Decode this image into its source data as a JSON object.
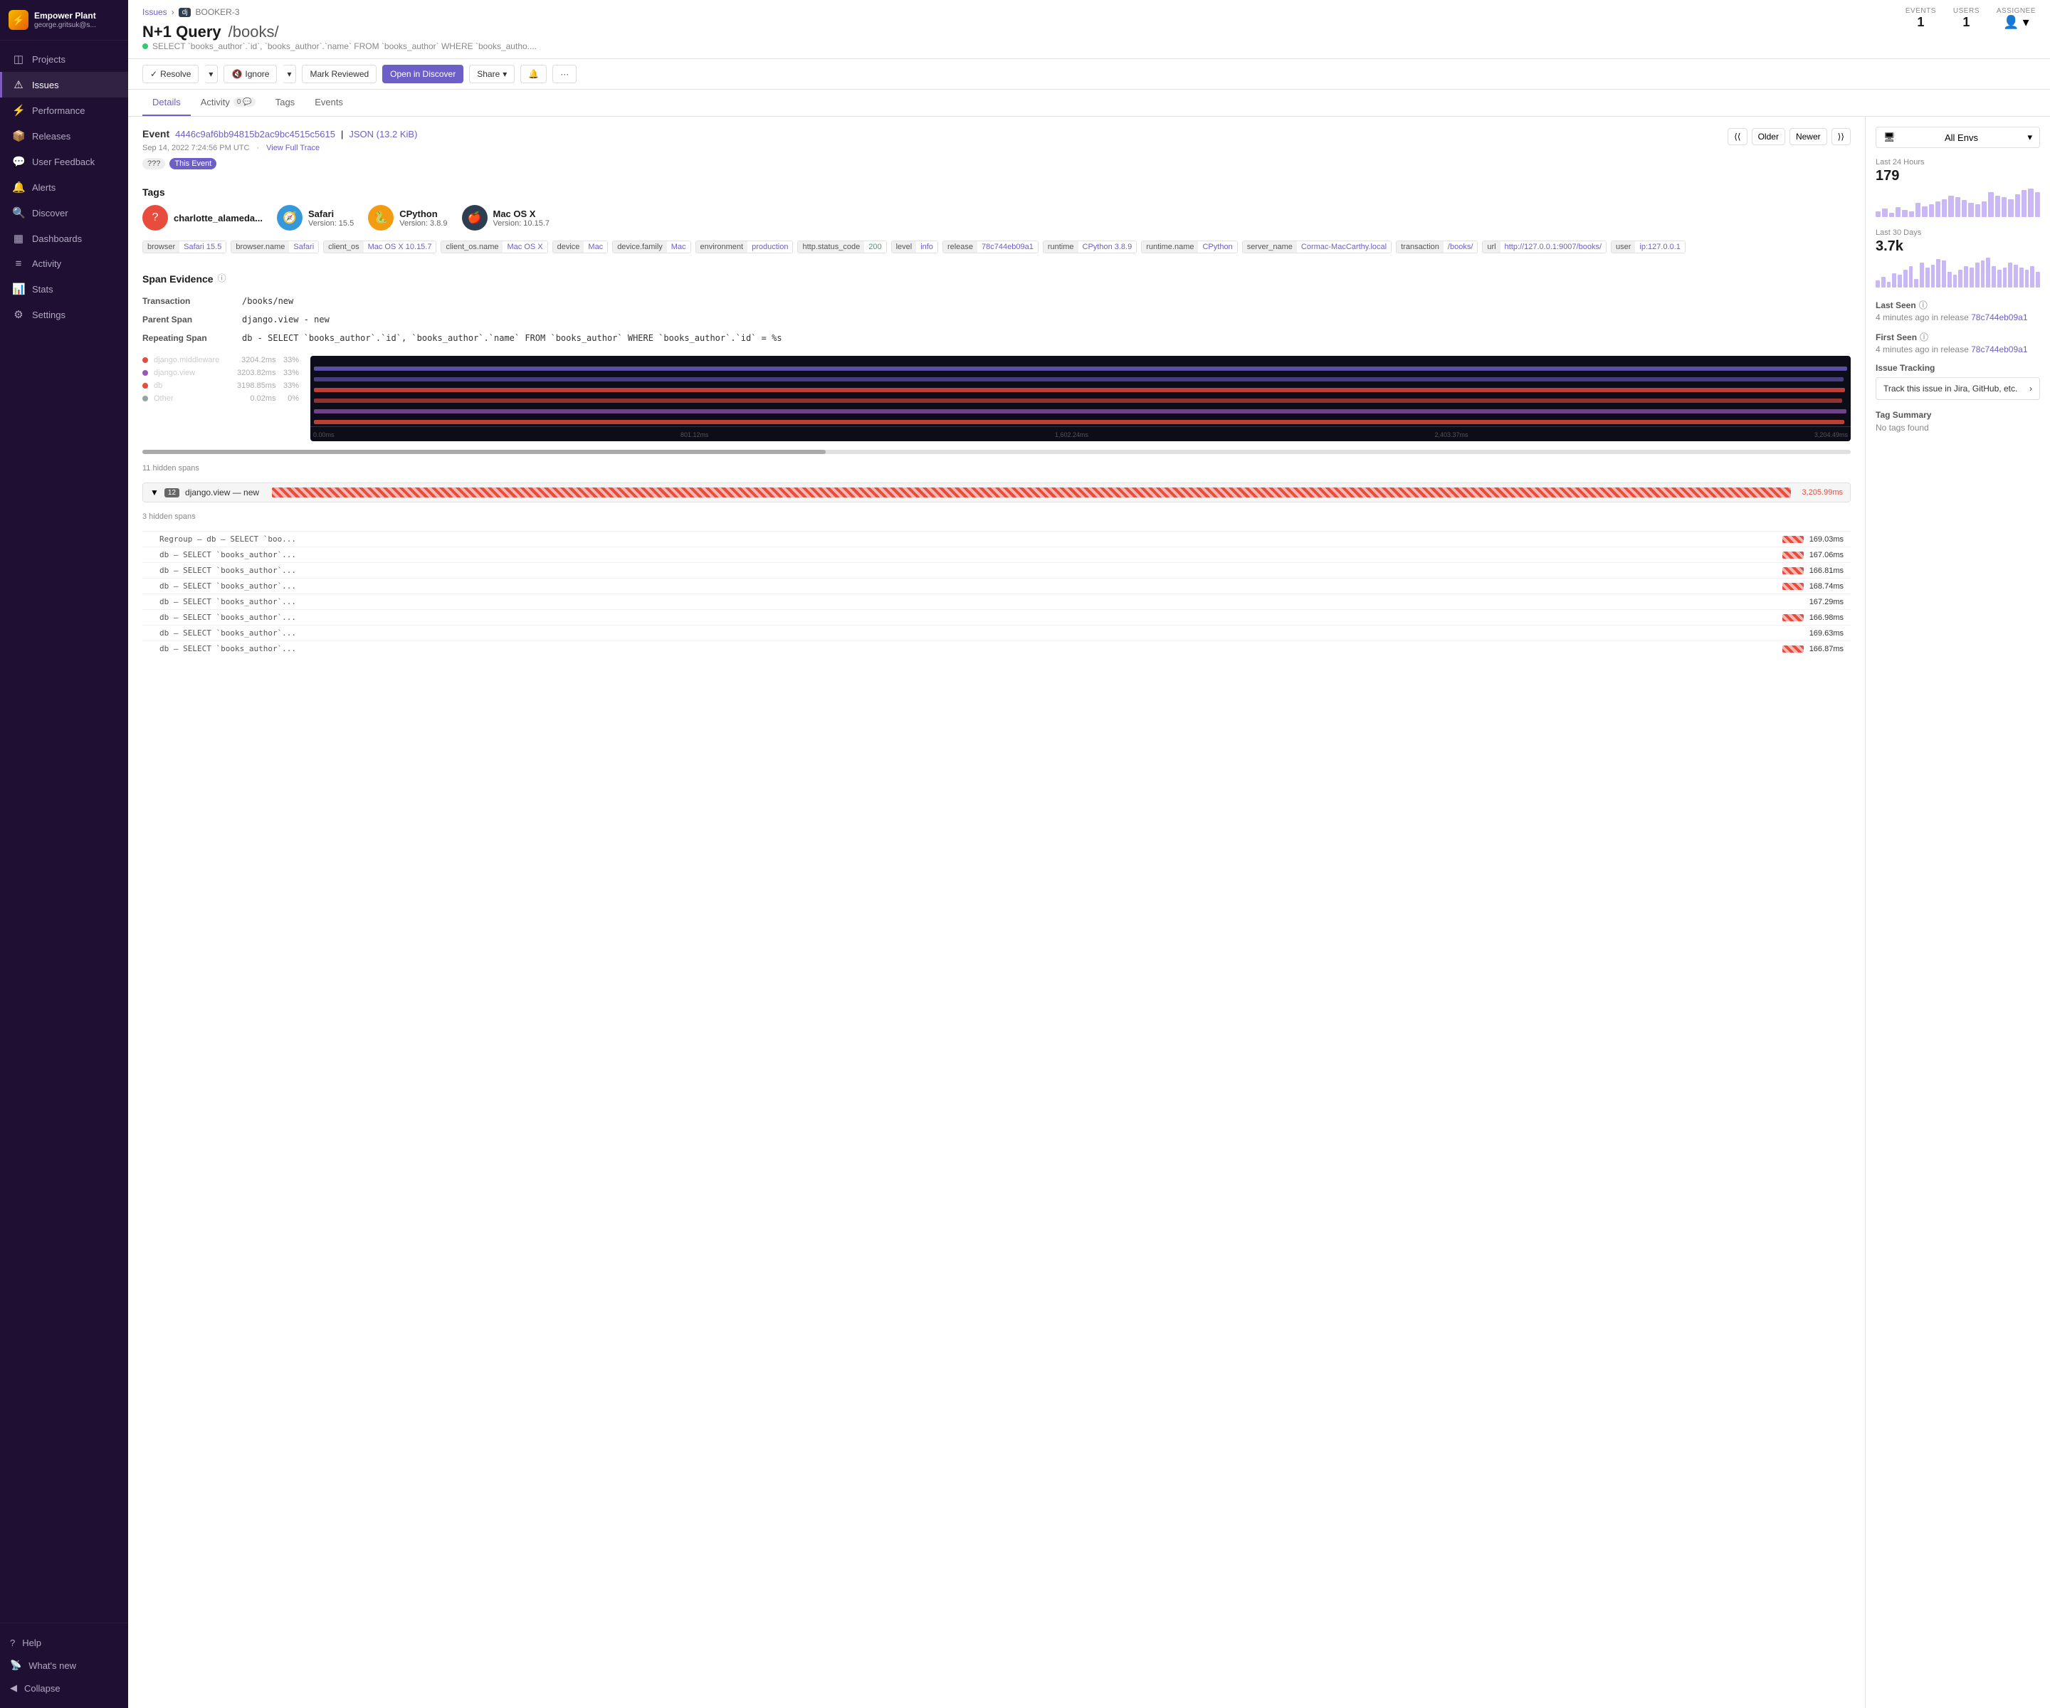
{
  "sidebar": {
    "logo": "⚡",
    "org_name": "Empower Plant",
    "org_user": "george.gritsuk@s...",
    "nav_items": [
      {
        "id": "projects",
        "label": "Projects",
        "icon": "◫",
        "active": false
      },
      {
        "id": "issues",
        "label": "Issues",
        "icon": "⚠",
        "active": true
      },
      {
        "id": "performance",
        "label": "Performance",
        "icon": "⚡",
        "active": false
      },
      {
        "id": "releases",
        "label": "Releases",
        "icon": "📦",
        "active": false
      },
      {
        "id": "user-feedback",
        "label": "User Feedback",
        "icon": "💬",
        "active": false
      },
      {
        "id": "alerts",
        "label": "Alerts",
        "icon": "🔔",
        "active": false
      },
      {
        "id": "discover",
        "label": "Discover",
        "icon": "🔍",
        "active": false
      },
      {
        "id": "dashboards",
        "label": "Dashboards",
        "icon": "▦",
        "active": false
      },
      {
        "id": "activity",
        "label": "Activity",
        "icon": "≡",
        "active": false
      },
      {
        "id": "stats",
        "label": "Stats",
        "icon": "📊",
        "active": false
      },
      {
        "id": "settings",
        "label": "Settings",
        "icon": "⚙",
        "active": false
      }
    ],
    "footer_items": [
      {
        "id": "help",
        "label": "Help",
        "icon": "?"
      },
      {
        "id": "whats-new",
        "label": "What's new",
        "icon": "📡"
      },
      {
        "id": "collapse",
        "label": "Collapse",
        "icon": "◀"
      }
    ]
  },
  "breadcrumb": {
    "issues_label": "Issues",
    "separator": "›",
    "project_icon": "dj",
    "issue_id": "BOOKER-3"
  },
  "issue": {
    "title": "N+1 Query",
    "path": "/books/",
    "query": "SELECT `books_author`.`id`, `books_author`.`name` FROM `books_author` WHERE `books_autho....",
    "events_label": "EVENTS",
    "events_value": "1",
    "users_label": "USERS",
    "users_value": "1",
    "assignee_label": "ASSIGNEE"
  },
  "actions": {
    "resolve": "Resolve",
    "ignore": "Ignore",
    "mark_reviewed": "Mark Reviewed",
    "open_in_discover": "Open in Discover",
    "share": "Share"
  },
  "tabs": [
    {
      "id": "details",
      "label": "Details",
      "active": true,
      "badge": null
    },
    {
      "id": "activity",
      "label": "Activity",
      "active": false,
      "badge": "0"
    },
    {
      "id": "tags",
      "label": "Tags",
      "active": false,
      "badge": null
    },
    {
      "id": "events",
      "label": "Events",
      "active": false,
      "badge": null
    }
  ],
  "event": {
    "label": "Event",
    "id": "4446c9af6bb94815b2ac9bc4515c5615",
    "json_label": "JSON (13.2 KiB)",
    "timestamp": "Sep 14, 2022 7:24:56 PM UTC",
    "view_full_trace": "View Full Trace",
    "badge_unknown": "???",
    "badge_this_event": "This Event"
  },
  "tags_section": {
    "title": "Tags",
    "tag_icons": [
      {
        "id": "user",
        "avatar_type": "red",
        "icon": "?",
        "name": "charlotte_alameda...",
        "version_label": ""
      },
      {
        "id": "safari",
        "avatar_type": "blue",
        "icon": "🧭",
        "name": "Safari",
        "version_label": "Version: 15.5"
      },
      {
        "id": "cpython",
        "avatar_type": "yellow",
        "icon": "🐍",
        "name": "CPython",
        "version_label": "Version: 3.8.9"
      },
      {
        "id": "macos",
        "avatar_type": "dark",
        "icon": "🍎",
        "name": "Mac OS X",
        "version_label": "Version: 10.15.7"
      }
    ],
    "pills": [
      {
        "key": "browser",
        "val": "Safari 15.5",
        "val_type": "normal"
      },
      {
        "key": "browser.name",
        "val": "Safari",
        "val_type": "normal"
      },
      {
        "key": "client_os",
        "val": "Mac OS X 10.15.7",
        "val_type": "normal"
      },
      {
        "key": "client_os.name",
        "val": "Mac OS X",
        "val_type": "normal"
      },
      {
        "key": "device",
        "val": "Mac",
        "val_type": "normal"
      },
      {
        "key": "device.family",
        "val": "Mac",
        "val_type": "normal"
      },
      {
        "key": "environment",
        "val": "production",
        "val_type": "normal"
      },
      {
        "key": "http.status_code",
        "val": "200",
        "val_type": "green"
      },
      {
        "key": "level",
        "val": "info",
        "val_type": "normal"
      },
      {
        "key": "release",
        "val": "78c744eb09a1",
        "val_type": "normal"
      },
      {
        "key": "runtime",
        "val": "CPython 3.8.9",
        "val_type": "normal"
      },
      {
        "key": "runtime.name",
        "val": "CPython",
        "val_type": "normal"
      },
      {
        "key": "server_name",
        "val": "Cormac-MacCarthy.local",
        "val_type": "normal"
      },
      {
        "key": "transaction",
        "val": "/books/",
        "val_type": "normal"
      },
      {
        "key": "url",
        "val": "http://127.0.0.1:9007/books/",
        "val_type": "normal"
      },
      {
        "key": "user",
        "val": "ip:127.0.0.1",
        "val_type": "normal"
      }
    ]
  },
  "span_evidence": {
    "title": "Span Evidence",
    "rows": [
      {
        "label": "Transaction",
        "value": "/books/new"
      },
      {
        "label": "Parent Span",
        "value": "django.view - new"
      },
      {
        "label": "Repeating Span",
        "value": "db - SELECT `books_author`.`id`, `books_author`.`name` FROM `books_author` WHERE `books_author`.`id` = %s"
      }
    ]
  },
  "performance": {
    "rows": [
      {
        "name": "django.middleware",
        "time": "3204.2ms",
        "pct": "33%",
        "color": "#e74c3c"
      },
      {
        "name": "django.view",
        "time": "3203.82ms",
        "pct": "33%",
        "color": "#9b59b6"
      },
      {
        "name": "db",
        "time": "3198.85ms",
        "pct": "33%",
        "color": "#e74c3c"
      },
      {
        "name": "Other",
        "time": "0.02ms",
        "pct": "0%",
        "color": "#95a5a6"
      }
    ],
    "timeline_labels": [
      "0.00ms",
      "801.12ms",
      "1,602.24ms",
      "2,403.37ms",
      "3,204.49ms"
    ]
  },
  "spans": {
    "hidden_11": "11 hidden spans",
    "span_number": "12",
    "span_name": "django.view — new",
    "span_duration": "3,205.99ms",
    "hidden_3": "3 hidden spans",
    "detail_rows": [
      {
        "name": "Regroup — db — SELECT `boo...",
        "time": "169.03ms",
        "has_bar": true
      },
      {
        "name": "db — SELECT `books_author`...",
        "time": "167.06ms",
        "has_bar": true
      },
      {
        "name": "db — SELECT `books_author`...",
        "time": "166.81ms",
        "has_bar": true
      },
      {
        "name": "db — SELECT `books_author`...",
        "time": "168.74ms",
        "has_bar": true
      },
      {
        "name": "db — SELECT `books_author`...",
        "time": "167.29ms",
        "has_bar": false
      },
      {
        "name": "db — SELECT `books_author`...",
        "time": "166.98ms",
        "has_bar": true
      },
      {
        "name": "db — SELECT `books_author`...",
        "time": "169.63ms",
        "has_bar": false
      },
      {
        "name": "db — SELECT `books_author`...",
        "time": "166.87ms",
        "has_bar": true
      }
    ]
  },
  "right_panel": {
    "env_selector": "All Envs",
    "last_24h_label": "Last 24 Hours",
    "last_24h_value": "179",
    "last_30d_label": "Last 30 Days",
    "last_30d_value": "3.7k",
    "last_seen_label": "Last Seen",
    "last_seen_value": "4 minutes ago in release",
    "last_seen_release": "78c744eb09a1",
    "first_seen_label": "First Seen",
    "first_seen_value": "4 minutes ago in release",
    "first_seen_release": "78c744eb09a1",
    "issue_tracking_label": "Issue Tracking",
    "tracking_btn": "Track this issue in Jira, GitHub, etc.",
    "tag_summary_label": "Tag Summary",
    "tag_summary_empty": "No tags found",
    "bar_heights_24h": [
      8,
      12,
      6,
      14,
      10,
      8,
      20,
      15,
      18,
      22,
      25,
      30,
      28,
      24,
      20,
      18,
      22,
      35,
      30,
      28,
      25,
      32,
      38,
      40,
      35
    ],
    "bar_heights_30d": [
      10,
      15,
      8,
      20,
      18,
      25,
      30,
      12,
      35,
      28,
      32,
      40,
      38,
      22,
      18,
      25,
      30,
      28,
      35,
      38,
      42,
      30,
      25,
      28,
      35,
      32,
      28,
      25,
      30,
      22
    ]
  }
}
